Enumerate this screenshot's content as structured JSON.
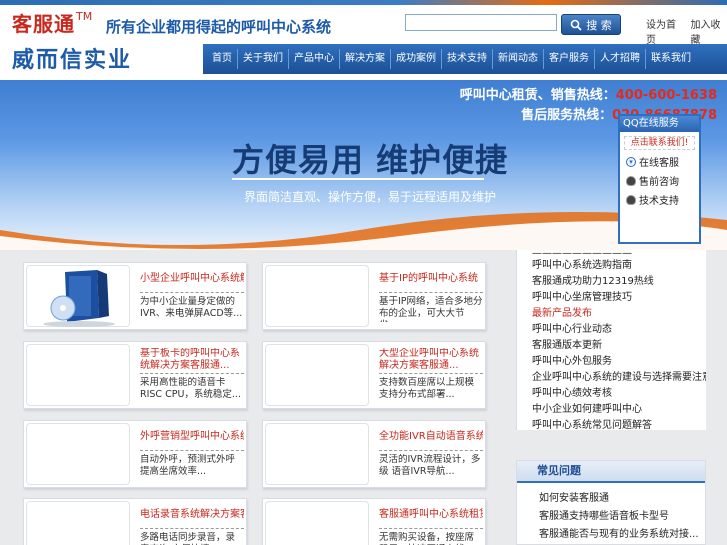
{
  "header": {
    "brand": "客服通",
    "tm": "TM",
    "company": "威而信实业",
    "slogan": "所有企业都用得起的呼叫中心系统",
    "search_placeholder": "",
    "search_button": "搜 索",
    "links": [
      "设为首页",
      "加入收藏"
    ]
  },
  "nav": [
    "首页",
    "关于我们",
    "产品中心",
    "解决方案",
    "成功案例",
    "技术支持",
    "新闻动态",
    "客户服务",
    "人才招聘",
    "联系我们"
  ],
  "banner": {
    "hotline1_label": "呼叫中心租赁、销售热线：",
    "hotline1_num": "400-600-1638",
    "hotline2_label": "售后服务热线：",
    "hotline2_num": "020-86687878",
    "title": "方便易用   维护便捷",
    "subtitle": "界面简洁直观、操作方便，易于远程适用及维护",
    "pager": "3"
  },
  "qq": {
    "title": "QQ在线服务",
    "contact": "点击联系我们!",
    "items": [
      "在线客服",
      "售前咨询",
      "技术支持"
    ]
  },
  "products": [
    {
      "title": "小型企业呼叫中心系统解决方案",
      "desc": "为中小企业量身定做的IVR、来电弹屏ACD等..."
    },
    {
      "title": "基于IP的呼叫中心系统",
      "desc": "基于IP网络，适合多地分布的企业，可大大节省..."
    },
    {
      "title": "基于板卡的呼叫中心系统解决方案客服通...",
      "desc": "采用高性能的语音卡RISC CPU，系统稳定..."
    },
    {
      "title": "大型企业呼叫中心系统解决方案客服通...",
      "desc": "支持数百座席以上规模 支持分布式部署..."
    },
    {
      "title": "外呼营销型呼叫中心系统解决方案",
      "desc": "自动外呼，预测式外呼    提高坐席效率..."
    },
    {
      "title": "全功能IVR自动语音系统",
      "desc": "灵活的IVR流程设计，多级 语音IVR导航..."
    },
    {
      "title": "电话录音系统解决方案客服通",
      "desc": "多路电话同步录音，录音查询 方便快捷..."
    },
    {
      "title": "客服通呼叫中心系统租赁服务",
      "desc": "无需购买设备，按座席租用，快速开通上线..."
    }
  ],
  "right_list": [
    {
      "text": "——————————",
      "red": false
    },
    {
      "text": "呼叫中心系统选购指南",
      "red": false
    },
    {
      "text": "客服通成功助力12319热线",
      "red": false
    },
    {
      "text": "呼叫中心坐席管理技巧",
      "red": false
    },
    {
      "text": "最新产品发布",
      "red": true
    },
    {
      "text": "呼叫中心行业动态",
      "red": false
    },
    {
      "text": "客服通版本更新",
      "red": false
    },
    {
      "text": "呼叫中心外包服务",
      "red": false
    },
    {
      "text": "企业呼叫中心系统的建设与选择需要注意",
      "red": false
    },
    {
      "text": "呼叫中心绩效考核",
      "red": false
    },
    {
      "text": "中小企业如何建呼叫中心",
      "red": false
    },
    {
      "text": "呼叫中心系统常见问题解答",
      "red": false
    }
  ],
  "right_panel": {
    "title": "常见问题",
    "items": [
      "如何安装客服通",
      "客服通支持哪些语音板卡型号",
      "客服通能否与现有的业务系统对接..."
    ]
  }
}
